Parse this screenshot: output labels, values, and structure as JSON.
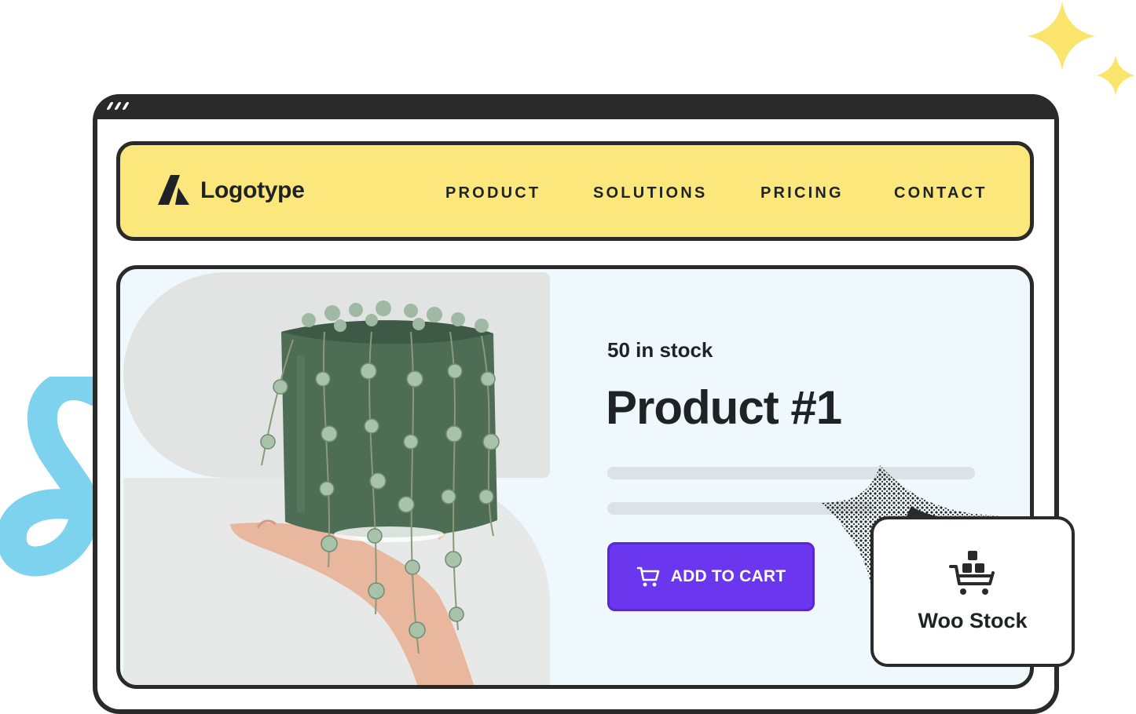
{
  "header": {
    "logo_text": "Logotype",
    "logo_icon": "logo-mark-icon"
  },
  "nav": {
    "items": [
      {
        "label": "PRODUCT"
      },
      {
        "label": "SOLUTIONS"
      },
      {
        "label": "PRICING"
      },
      {
        "label": "CONTACT"
      }
    ]
  },
  "product": {
    "stock_text": "50 in stock",
    "title": "Product #1",
    "add_to_cart_label": "ADD TO CART",
    "cart_icon": "cart-icon"
  },
  "badge": {
    "label": "Woo Stock",
    "icon": "stock-cart-icon"
  },
  "colors": {
    "nav_background": "#fce77d",
    "card_background": "#eff8fd",
    "button": "#6b37ee",
    "frame": "#2a2a2a",
    "sparkle": "#fbe46b",
    "squiggle": "#7dd3ee"
  }
}
